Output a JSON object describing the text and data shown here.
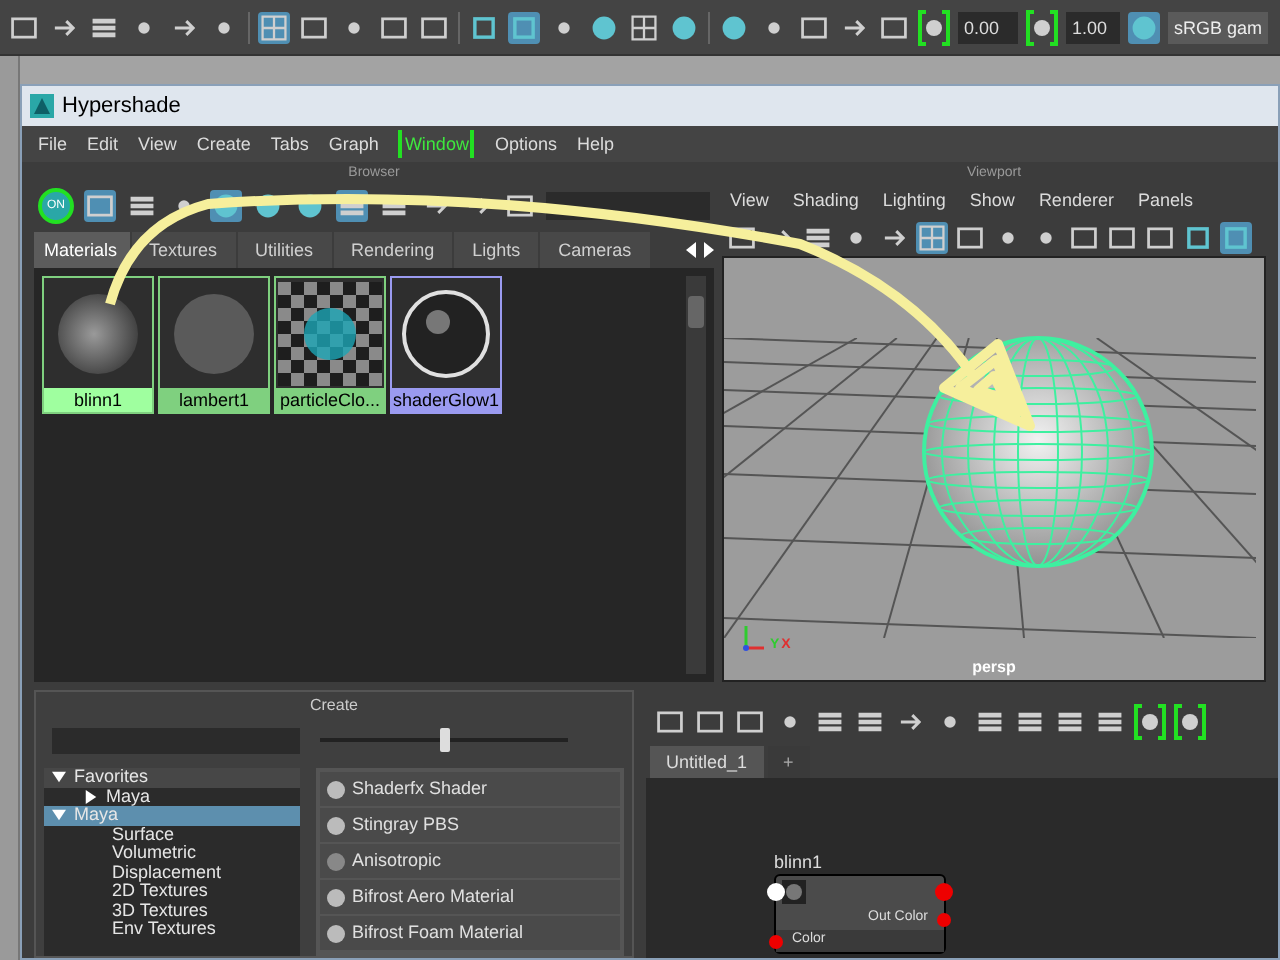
{
  "main_toolbar": {
    "exposure": "0.00",
    "gamma": "1.00",
    "color_space": "sRGB gam"
  },
  "window": {
    "title": "Hypershade"
  },
  "menu": [
    {
      "label": "File",
      "highlighted": false
    },
    {
      "label": "Edit",
      "highlighted": false
    },
    {
      "label": "View",
      "highlighted": false
    },
    {
      "label": "Create",
      "highlighted": false
    },
    {
      "label": "Tabs",
      "highlighted": false
    },
    {
      "label": "Graph",
      "highlighted": false
    },
    {
      "label": "Window",
      "highlighted": true
    },
    {
      "label": "Options",
      "highlighted": false
    },
    {
      "label": "Help",
      "highlighted": false
    }
  ],
  "browser": {
    "title": "Browser",
    "toggle": "ON",
    "tabs": [
      {
        "label": "Materials",
        "selected": true
      },
      {
        "label": "Textures",
        "selected": false
      },
      {
        "label": "Utilities",
        "selected": false
      },
      {
        "label": "Rendering",
        "selected": false
      },
      {
        "label": "Lights",
        "selected": false
      },
      {
        "label": "Cameras",
        "selected": false
      }
    ],
    "materials": [
      {
        "name": "blinn1",
        "kind": "shiny",
        "color": "#7fd07f",
        "selected": true
      },
      {
        "name": "lambert1",
        "kind": "matte",
        "color": "#7fd07f",
        "selected": false
      },
      {
        "name": "particleClo...",
        "kind": "checker",
        "color": "#7fd07f",
        "selected": false
      },
      {
        "name": "shaderGlow1",
        "kind": "glow",
        "color": "#9a9af0",
        "selected": false
      }
    ]
  },
  "viewport": {
    "title": "Viewport",
    "menu": [
      "View",
      "Shading",
      "Lighting",
      "Show",
      "Renderer",
      "Panels"
    ],
    "camera": "persp",
    "axis_y": "Y",
    "axis_x": "X"
  },
  "create": {
    "title": "Create",
    "slider": {
      "level": 0.5
    },
    "tree": [
      {
        "label": "Favorites",
        "expanded": true,
        "selected": false,
        "children": [
          {
            "label": "Maya",
            "expanded": false,
            "selected": false
          }
        ]
      },
      {
        "label": "Maya",
        "expanded": true,
        "selected": true,
        "children": [
          {
            "label": "Surface"
          },
          {
            "label": "Volumetric"
          },
          {
            "label": "Displacement"
          },
          {
            "label": "2D Textures"
          },
          {
            "label": "3D Textures"
          },
          {
            "label": "Env Textures"
          }
        ]
      }
    ],
    "shaders": [
      {
        "label": "Shaderfx Shader",
        "kind": "sphere"
      },
      {
        "label": "Stingray PBS",
        "kind": "sphere"
      },
      {
        "label": "Anisotropic",
        "kind": "flat"
      },
      {
        "label": "Bifrost Aero Material",
        "kind": "sphere"
      },
      {
        "label": "Bifrost Foam Material",
        "kind": "sphere"
      }
    ]
  },
  "node_editor": {
    "tabs": [
      {
        "label": "Untitled_1",
        "selected": true
      },
      {
        "label": "+",
        "selected": false
      }
    ],
    "node": {
      "name": "blinn1",
      "output": "Out Color",
      "input": "Color"
    }
  }
}
